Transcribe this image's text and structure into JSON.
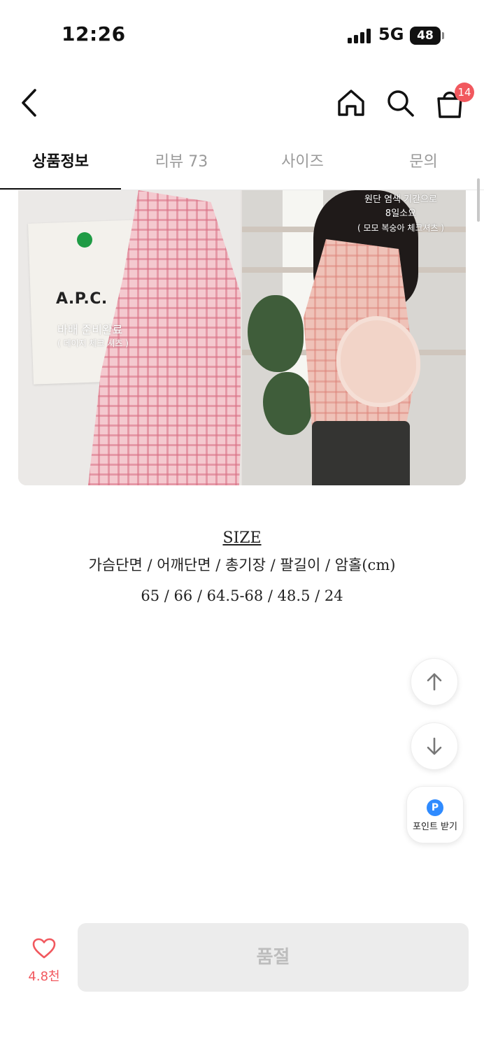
{
  "status_bar": {
    "time": "12:26",
    "network": "5G",
    "battery": "48"
  },
  "header": {
    "cart_count": "14"
  },
  "tabs": [
    {
      "label": "상품정보",
      "active": true
    },
    {
      "label": "리뷰 73",
      "active": false
    },
    {
      "label": "사이즈",
      "active": false
    },
    {
      "label": "문의",
      "active": false
    }
  ],
  "product_image": {
    "left_logo": "A.P.C.",
    "left_caption": "바배 준비완료",
    "left_caption_sub": "( 데이지 체크 셔츠 )",
    "right_caption_1": "원단 염색 기간으로",
    "right_caption_2": "8일소요",
    "right_caption_3": "( 모모 복숭아 체크셔츠 )"
  },
  "size_info": {
    "title": "SIZE",
    "columns": "가슴단면 / 어깨단면 / 총기장 / 팔길이 / 암홀(cm)",
    "values": "65 / 66 / 64.5-68 / 48.5 / 24"
  },
  "floating": {
    "point_icon": "P",
    "point_label": "포인트 받기"
  },
  "bottom_bar": {
    "like_count": "4.8천",
    "sold_out_label": "품절"
  },
  "colors": {
    "accent": "#f1585e",
    "point_blue": "#2f8bff",
    "disabled_bg": "#ececec",
    "disabled_text": "#bdbdbd"
  },
  "icons": {
    "back": "chevron-left-icon",
    "home": "home-icon",
    "search": "search-icon",
    "cart": "shopping-bag-icon",
    "scroll_up": "arrow-up-icon",
    "scroll_down": "arrow-down-icon",
    "like": "heart-icon"
  }
}
